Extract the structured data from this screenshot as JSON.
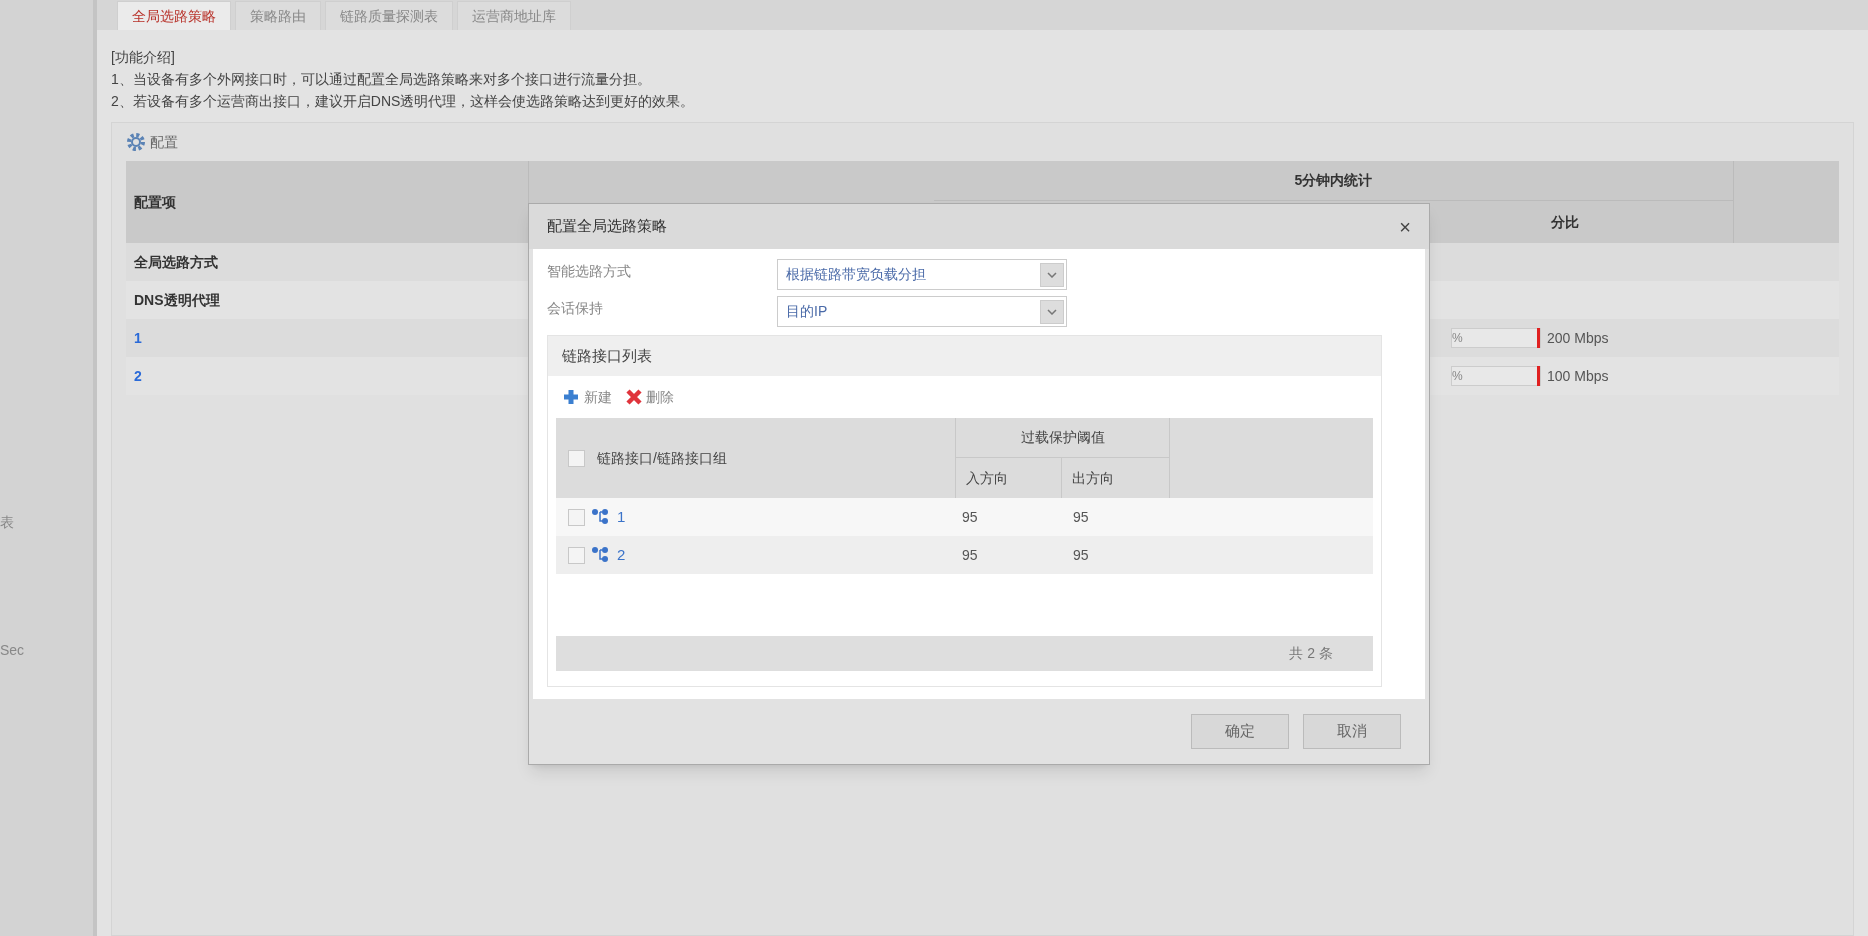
{
  "sidebar": {
    "items": [
      "表",
      "Sec"
    ]
  },
  "tabs": [
    {
      "label": "全局选路策略",
      "selected": true
    },
    {
      "label": "策略路由",
      "selected": false
    },
    {
      "label": "链路质量探测表",
      "selected": false
    },
    {
      "label": "运营商地址库",
      "selected": false
    }
  ],
  "intro": {
    "title": "[功能介绍]",
    "lines": [
      "1、当设备有多个外网接口时，可以通过配置全局选路策略来对多个接口进行流量分担。",
      "2、若设备有多个运营商出接口，建议开启DNS透明代理，这样会使选路策略达到更好的效果。"
    ]
  },
  "config_button": "配置",
  "table": {
    "first_column": "配置项",
    "stats_header": "5分钟内统计",
    "stats_subheader": "分比",
    "rows": [
      {
        "kind": "setting",
        "label": "全局选路方式"
      },
      {
        "kind": "setting",
        "label": "DNS透明代理"
      },
      {
        "kind": "link",
        "label": "1",
        "percent": "%",
        "bandwidth": "200 Mbps"
      },
      {
        "kind": "link",
        "label": "2",
        "percent": "%",
        "bandwidth": "100 Mbps"
      }
    ]
  },
  "dialog": {
    "title": "配置全局选路策略",
    "close": "×",
    "fields": [
      {
        "label": "智能选路方式",
        "value": "根据链路带宽负载分担"
      },
      {
        "label": "会话保持",
        "value": "目的IP"
      }
    ],
    "panel": {
      "title": "链路接口列表",
      "actions": [
        {
          "kind": "add",
          "label": "新建"
        },
        {
          "kind": "delete",
          "label": "删除"
        }
      ],
      "columns": {
        "name": "链路接口/链路接口组",
        "group": "过载保护阈值",
        "in": "入方向",
        "out": "出方向"
      },
      "all_checked": false,
      "rows": [
        {
          "name": "1",
          "in": "95",
          "out": "95",
          "checked": false
        },
        {
          "name": "2",
          "in": "95",
          "out": "95",
          "checked": false
        }
      ],
      "footer": "共 2 条"
    },
    "buttons": [
      "确定",
      "取消"
    ]
  }
}
